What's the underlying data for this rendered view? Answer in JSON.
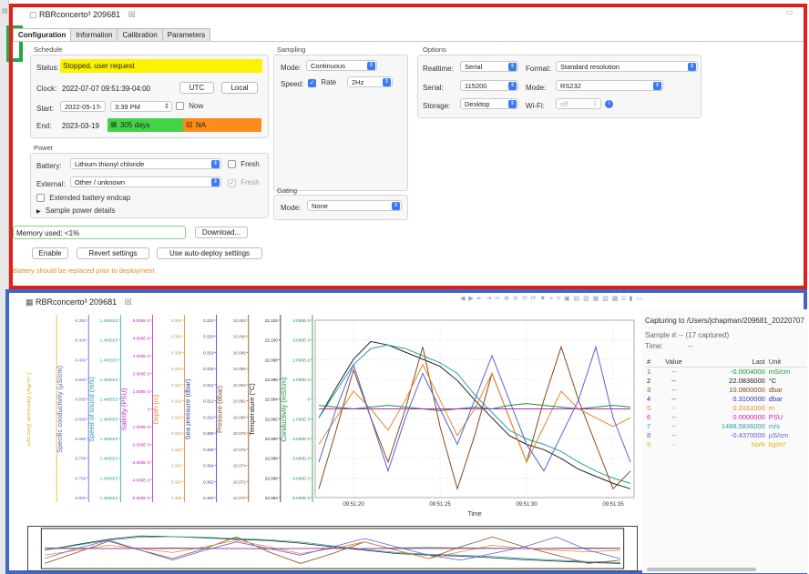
{
  "window": {
    "title": "RBRconcerto³ 209681",
    "close_glyph": "☒",
    "minimize_glyph": "▭"
  },
  "tabs": [
    {
      "label": "Configuration",
      "active": true
    },
    {
      "label": "Information",
      "active": false
    },
    {
      "label": "Calibration",
      "active": false
    },
    {
      "label": "Parameters",
      "active": false
    }
  ],
  "schedule": {
    "section": "Schedule",
    "status_label": "Status:",
    "status_value": "Stopped, user request",
    "clock_label": "Clock:",
    "clock_value": "2022-07-07 09:51:39-04:00",
    "utc_button": "UTC",
    "local_button": "Local",
    "start_label": "Start:",
    "start_date": "2022-05-17",
    "start_time": "3:39 PM",
    "now_label": "Now",
    "end_label": "End:",
    "end_date": "2023-03-19",
    "end_days": "305 days",
    "end_na": "NA",
    "colors": {
      "status": "#fff200",
      "days": "#45d24b",
      "na": "#ff8a1e"
    }
  },
  "power": {
    "section": "Power",
    "battery_label": "Battery:",
    "battery_value": "Lithium thionyl chloride",
    "fresh_label": "Fresh",
    "external_label": "External:",
    "external_value": "Other / unknown",
    "external_fresh_label": "Fresh",
    "extended_label": "Extended battery endcap",
    "sample_power_label": "Sample power details"
  },
  "sampling": {
    "section": "Sampling",
    "mode_label": "Mode:",
    "mode_value": "Continuous",
    "speed_label": "Speed:",
    "rate_label": "Rate",
    "rate_value": "2Hz"
  },
  "gating": {
    "section": "Gating",
    "mode_label": "Mode:",
    "mode_value": "None"
  },
  "options": {
    "section": "Options",
    "realtime_label": "Realtime:",
    "realtime_value": "Serial",
    "format_label": "Format:",
    "format_value": "Standard resolution",
    "serial_label": "Serial:",
    "serial_value": "115200",
    "mode_label": "Mode:",
    "mode_value": "RS232",
    "storage_label": "Storage:",
    "storage_value": "Desktop",
    "wifi_label": "Wi-Fi:",
    "wifi_value": "off"
  },
  "memory": {
    "label": "Memory used: <1%",
    "download_button": "Download..."
  },
  "actions": {
    "enable": "Enable",
    "revert": "Revert settings",
    "auto_deploy": "Use auto-deploy settings"
  },
  "warning": "Battery should be replaced prior to deployment",
  "plot_tab": {
    "title": "RBRconcerto³ 209681",
    "close_glyph": "☒"
  },
  "capture": {
    "path": "Capturing to /Users/jchapman/209681_20220707",
    "sample_label": "Sample #:",
    "sample_value": "-- (17 captured)",
    "time_label": "Time:",
    "time_value": "--",
    "columns": [
      "#",
      "Value",
      "Last",
      "Unit"
    ],
    "rows": [
      {
        "n": "1",
        "value": "--",
        "last": "-0.0004000",
        "unit": "mS/cm",
        "color": "#1a8f3c"
      },
      {
        "n": "2",
        "value": "--",
        "last": "22.0836000",
        "unit": "°C",
        "color": "#222222"
      },
      {
        "n": "3",
        "value": "--",
        "last": "10.0800000",
        "unit": "dbar",
        "color": "#8a4a1a"
      },
      {
        "n": "4",
        "value": "--",
        "last": "0.3100000",
        "unit": "dbar",
        "color": "#2a3aa8"
      },
      {
        "n": "5",
        "value": "--",
        "last": "0.3161000",
        "unit": "m",
        "color": "#e08a2a"
      },
      {
        "n": "6",
        "value": "--",
        "last": "0.0000000",
        "unit": "PSU",
        "color": "#c020c0"
      },
      {
        "n": "7",
        "value": "--",
        "last": "1488.5836000",
        "unit": "m/s",
        "color": "#2aa0a8"
      },
      {
        "n": "8",
        "value": "--",
        "last": "-0.4370000",
        "unit": "µS/cm",
        "color": "#5a60d8"
      },
      {
        "n": "9",
        "value": "--",
        "last": "NaN",
        "unit": "kg/m³",
        "color": "#e0b010"
      }
    ]
  },
  "chart_data": {
    "type": "line",
    "xlabel": "Time",
    "x_ticks": [
      "09:51:20",
      "09:51:25",
      "09:51:30",
      "09:51:35"
    ],
    "x": [
      "09:51:18",
      "09:51:19",
      "09:51:20",
      "09:51:21",
      "09:51:22",
      "09:51:23",
      "09:51:24",
      "09:51:25",
      "09:51:26",
      "09:51:27",
      "09:51:28",
      "09:51:29",
      "09:51:30",
      "09:51:31",
      "09:51:32",
      "09:51:33",
      "09:51:34",
      "09:51:35",
      "09:51:36"
    ],
    "axes": [
      {
        "label": "Density anomaly (kg/m³)",
        "color": "#e0b010",
        "ticks": []
      },
      {
        "label": "Specific conductivity (µS/cm)",
        "color": "#5a60d8",
        "ticks": [
          "-0.350",
          "-0.400",
          "-0.450",
          "-0.500",
          "-0.550",
          "-0.600",
          "-0.650",
          "-0.700",
          "-0.750",
          "-0.800"
        ]
      },
      {
        "label": "Speed of sound (m/s)",
        "color": "#2aa0a8",
        "ticks": [
          "1.4885E3",
          "1.4885E3",
          "1.4885E3",
          "1.4885E3",
          "1.4885E3",
          "1.4885E3",
          "1.4885E3",
          "1.4885E3",
          "1.4885E3",
          "1.4885E3"
        ]
      },
      {
        "label": "Salinity (PSU)",
        "color": "#c020c0",
        "ticks": [
          "5.000E-3",
          "4.000E-3",
          "3.000E-3",
          "2.000E-3",
          "1.000E-3",
          "0",
          "-1.000E-3",
          "-2.000E-3",
          "-3.000E-3",
          "-4.000E-3",
          "-5.000E-3"
        ]
      },
      {
        "label": "Depth (m)",
        "color": "#e08a2a",
        "ticks": [
          "0.304",
          "0.306",
          "0.308",
          "0.310",
          "0.312",
          "0.314",
          "0.316",
          "0.318",
          "0.320",
          "0.322",
          "0.324",
          "0.326"
        ]
      },
      {
        "label": "Sea pressure (dbar)",
        "color": "#2a3aa8",
        "ticks": [
          "0.322",
          "0.320",
          "0.318",
          "0.316",
          "0.314",
          "0.312",
          "0.310",
          "0.308",
          "0.306",
          "0.304",
          "0.302",
          "0.300"
        ]
      },
      {
        "label": "Pressure (dbar)",
        "color": "#8a4a1a",
        "ticks": [
          "10.092",
          "10.090",
          "10.088",
          "10.086",
          "10.084",
          "10.082",
          "10.080",
          "10.078",
          "10.076",
          "10.074",
          "10.072",
          "10.070"
        ]
      },
      {
        "label": "Temperature (°C)",
        "color": "#222222",
        "ticks": [
          "22.102",
          "22.100",
          "22.098",
          "22.096",
          "22.094",
          "22.092",
          "22.090",
          "22.088",
          "22.086",
          "22.084"
        ]
      },
      {
        "label": "Conductivity (mS/cm)",
        "color": "#1a8f3c",
        "ticks": [
          "4.000E-3",
          "3.000E-3",
          "2.000E-3",
          "1.000E-3",
          "0",
          "-1.000E-3",
          "-2.000E-3",
          "-3.000E-3",
          "-4.000E-3",
          "-5.000E-3"
        ]
      }
    ],
    "series": [
      {
        "color": "#222222",
        "values": [
          0.45,
          0.62,
          0.78,
          0.88,
          0.86,
          0.82,
          0.78,
          0.74,
          0.66,
          0.55,
          0.45,
          0.35,
          0.3,
          0.27,
          0.22,
          0.16,
          0.12,
          0.08,
          0.05
        ]
      },
      {
        "color": "#2aa0a8",
        "values": [
          0.45,
          0.6,
          0.75,
          0.84,
          0.86,
          0.84,
          0.8,
          0.76,
          0.7,
          0.58,
          0.48,
          0.38,
          0.33,
          0.3,
          0.26,
          0.2,
          0.15,
          0.11,
          0.08
        ]
      },
      {
        "color": "#8a4a1a",
        "values": [
          0.05,
          0.38,
          0.72,
          0.45,
          0.2,
          0.5,
          0.85,
          0.4,
          0.05,
          0.35,
          0.7,
          0.45,
          0.2,
          0.55,
          0.85,
          0.55,
          0.3,
          0.05,
          0.15
        ]
      },
      {
        "color": "#e08a2a",
        "values": [
          0.3,
          0.45,
          0.6,
          0.5,
          0.38,
          0.55,
          0.75,
          0.55,
          0.35,
          0.5,
          0.7,
          0.45,
          0.2,
          0.4,
          0.6,
          0.5,
          0.45,
          0.4,
          0.45
        ]
      },
      {
        "color": "#5a60d8",
        "values": [
          0.2,
          0.5,
          0.75,
          0.45,
          0.15,
          0.45,
          0.7,
          0.5,
          0.3,
          0.55,
          0.8,
          0.55,
          0.3,
          0.15,
          0.35,
          0.55,
          0.85,
          0.45,
          0.2
        ]
      },
      {
        "color": "#1a8f3c",
        "values": [
          0.52,
          0.51,
          0.5,
          0.51,
          0.52,
          0.51,
          0.5,
          0.49,
          0.5,
          0.51,
          0.5,
          0.52,
          0.53,
          0.52,
          0.51,
          0.5,
          0.51,
          0.52,
          0.51
        ]
      },
      {
        "color": "#c020c0",
        "values": [
          0.5,
          0.5,
          0.5,
          0.5,
          0.5,
          0.5,
          0.5,
          0.5,
          0.5,
          0.5,
          0.5,
          0.5,
          0.5,
          0.5,
          0.5,
          0.5,
          0.5,
          0.5,
          0.5
        ]
      }
    ]
  }
}
